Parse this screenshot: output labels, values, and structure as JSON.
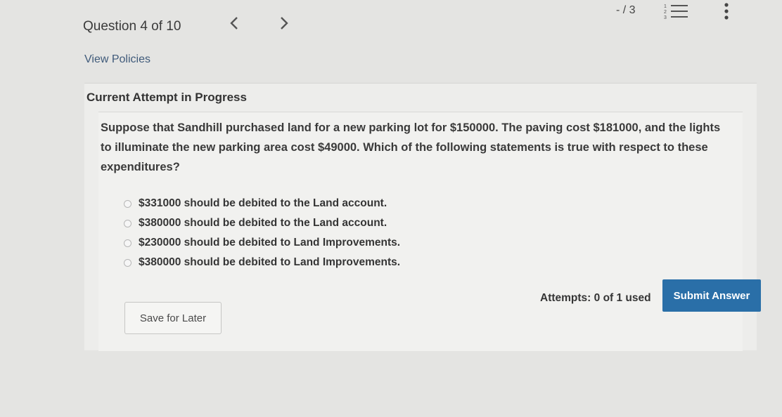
{
  "header": {
    "question_counter": "Question 4 of 10",
    "score": "- / 3",
    "prev_label": "previous-question",
    "next_label": "next-question"
  },
  "links": {
    "view_policies": "View Policies"
  },
  "attempt": {
    "title": "Current Attempt in Progress"
  },
  "question": {
    "text": "Suppose that Sandhill purchased land for a new parking lot for $150000. The paving cost $181000, and the lights to illuminate the new parking area cost $49000. Which of the following statements is true with respect to these expenditures?",
    "options": [
      "$331000 should be debited to the Land account.",
      "$380000 should be debited to the Land account.",
      "$230000 should be debited to Land Improvements.",
      "$380000 should be debited to Land Improvements."
    ]
  },
  "footer": {
    "save_label": "Save for Later",
    "attempts_text": "Attempts: 0 of 1 used",
    "submit_label": "Submit Answer"
  },
  "icons": {
    "prev": "chevron-left-icon",
    "next": "chevron-right-icon",
    "list": "numbered-list-icon",
    "more": "vertical-dots-icon"
  },
  "colors": {
    "submit_bg": "#2a6fa8",
    "link": "#3f5a7a"
  }
}
